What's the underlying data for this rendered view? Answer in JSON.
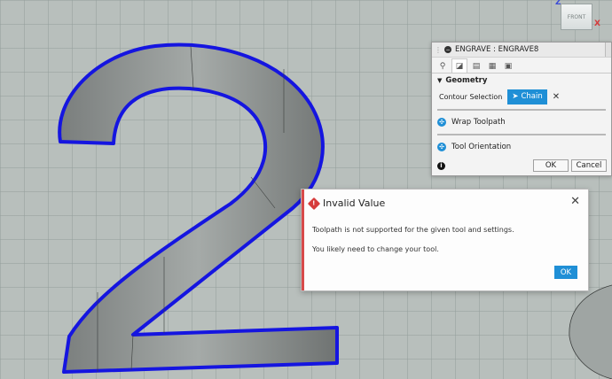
{
  "viewcube": {
    "face_label": "FRONT",
    "axis_z": "Z",
    "axis_x": "X"
  },
  "engrave_panel": {
    "title": "ENGRAVE : ENGRAVE8",
    "tabs": [
      {
        "icon": "tool-icon"
      },
      {
        "icon": "geometry-icon"
      },
      {
        "icon": "heights-icon"
      },
      {
        "icon": "passes-icon"
      },
      {
        "icon": "linking-icon"
      }
    ],
    "section_label": "Geometry",
    "contour_selection_label": "Contour Selection",
    "chain_label": "Chain",
    "clear_symbol": "✕",
    "wrap_toolpath_label": "Wrap Toolpath",
    "tool_orientation_label": "Tool Orientation",
    "ok_label": "OK",
    "cancel_label": "Cancel"
  },
  "dialog": {
    "title": "Invalid Value",
    "message_line1": "Toolpath is not supported for the given tool and settings.",
    "message_line2": "You likely need to change your tool.",
    "ok_label": "OK",
    "close_symbol": "✕"
  },
  "colors": {
    "accent": "#1f8fd6",
    "contour": "#1515e0",
    "error": "#d63b3b",
    "canvas": "#b8bfbc"
  }
}
